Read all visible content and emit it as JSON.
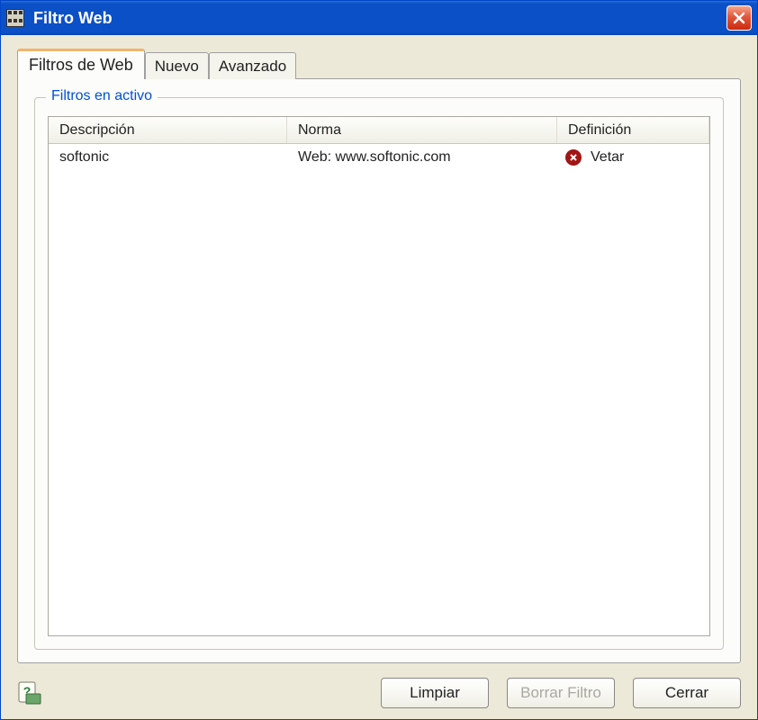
{
  "window": {
    "title": "Filtro Web"
  },
  "tabs": [
    {
      "label": "Filtros de Web",
      "active": true
    },
    {
      "label": "Nuevo",
      "active": false
    },
    {
      "label": "Avanzado",
      "active": false
    }
  ],
  "groupbox": {
    "label": "Filtros en activo"
  },
  "columns": {
    "descripcion": "Descripción",
    "norma": "Norma",
    "definicion": "Definición"
  },
  "rows": [
    {
      "descripcion": "softonic",
      "norma": "Web: www.softonic.com",
      "definicion": "Vetar",
      "icon": "deny"
    }
  ],
  "buttons": {
    "limpiar": "Limpiar",
    "borrar_filtro": "Borrar Filtro",
    "cerrar": "Cerrar"
  }
}
